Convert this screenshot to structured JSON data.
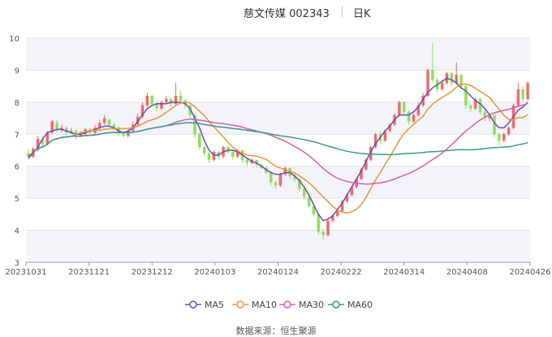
{
  "header": {
    "title": "慈文传媒 002343",
    "period": "日K"
  },
  "source": "数据来源：恒生聚源",
  "colors": {
    "up": "#f06a6a",
    "down": "#8ee05a",
    "ma5": "#6a4bb5",
    "ma10": "#e8953c",
    "ma30": "#d65fae",
    "ma60": "#3d9694"
  },
  "chart_data": {
    "type": "candlestick",
    "title": "慈文传媒 002343",
    "period": "日K",
    "ylim": [
      3,
      10
    ],
    "yticks": [
      "3",
      "4",
      "5",
      "6",
      "7",
      "8",
      "9",
      "10"
    ],
    "xticks": [
      "20231031",
      "20231121",
      "20231212",
      "20240103",
      "20240124",
      "20240222",
      "20240314",
      "20240408",
      "20240426"
    ],
    "grid": true,
    "legend_position": "bottom",
    "legend": [
      "MA5",
      "MA10",
      "MA30",
      "MA60"
    ],
    "candles": [
      [
        6.4,
        6.3,
        6.55,
        6.2
      ],
      [
        6.3,
        6.55,
        6.6,
        6.25
      ],
      [
        6.5,
        6.85,
        6.95,
        6.45
      ],
      [
        6.85,
        6.7,
        6.95,
        6.6
      ],
      [
        6.7,
        7.05,
        7.1,
        6.65
      ],
      [
        7.05,
        7.4,
        7.45,
        7.0
      ],
      [
        7.35,
        7.15,
        7.45,
        7.05
      ],
      [
        7.15,
        7.2,
        7.3,
        7.05
      ],
      [
        7.2,
        7.05,
        7.25,
        6.95
      ],
      [
        7.05,
        7.1,
        7.2,
        7.0
      ],
      [
        7.1,
        6.95,
        7.15,
        6.85
      ],
      [
        6.95,
        7.0,
        7.1,
        6.9
      ],
      [
        7.0,
        7.15,
        7.2,
        6.95
      ],
      [
        7.15,
        7.05,
        7.2,
        7.0
      ],
      [
        7.05,
        7.2,
        7.3,
        7.0
      ],
      [
        7.2,
        7.35,
        7.45,
        7.15
      ],
      [
        7.35,
        7.5,
        7.6,
        7.3
      ],
      [
        7.45,
        7.3,
        7.5,
        7.2
      ],
      [
        7.3,
        7.2,
        7.35,
        7.1
      ],
      [
        7.2,
        7.05,
        7.25,
        6.95
      ],
      [
        7.05,
        6.95,
        7.1,
        6.9
      ],
      [
        6.95,
        7.1,
        7.15,
        6.9
      ],
      [
        7.1,
        7.3,
        7.4,
        7.05
      ],
      [
        7.3,
        7.55,
        7.65,
        7.25
      ],
      [
        7.55,
        7.9,
        8.0,
        7.5
      ],
      [
        7.9,
        8.2,
        8.3,
        7.85
      ],
      [
        8.2,
        7.95,
        8.25,
        7.85
      ],
      [
        7.95,
        7.8,
        8.0,
        7.7
      ],
      [
        7.8,
        8.0,
        8.05,
        7.75
      ],
      [
        8.0,
        8.1,
        8.2,
        7.95
      ],
      [
        8.1,
        7.95,
        8.15,
        7.85
      ],
      [
        7.95,
        8.2,
        8.6,
        7.9
      ],
      [
        8.2,
        8.05,
        8.35,
        7.95
      ],
      [
        8.05,
        7.9,
        8.1,
        7.8
      ],
      [
        7.9,
        7.6,
        7.95,
        7.5
      ],
      [
        7.6,
        7.0,
        7.65,
        6.9
      ],
      [
        7.0,
        6.6,
        7.05,
        6.5
      ],
      [
        6.6,
        6.4,
        6.65,
        6.3
      ],
      [
        6.4,
        6.2,
        6.45,
        6.1
      ],
      [
        6.2,
        6.45,
        6.5,
        6.15
      ],
      [
        6.45,
        6.3,
        6.5,
        6.2
      ],
      [
        6.3,
        6.6,
        6.65,
        6.25
      ],
      [
        6.6,
        6.45,
        6.65,
        6.4
      ],
      [
        6.45,
        6.3,
        6.5,
        6.2
      ],
      [
        6.3,
        6.5,
        6.55,
        6.25
      ],
      [
        6.5,
        6.2,
        6.5,
        6.1
      ],
      [
        6.2,
        6.1,
        6.25,
        6.0
      ],
      [
        6.1,
        6.2,
        6.25,
        6.05
      ],
      [
        6.2,
        6.05,
        6.2,
        5.95
      ],
      [
        6.05,
        5.95,
        6.1,
        5.9
      ],
      [
        5.95,
        5.8,
        6.0,
        5.75
      ],
      [
        5.8,
        5.5,
        5.85,
        5.4
      ],
      [
        5.5,
        5.4,
        5.55,
        5.3
      ],
      [
        5.4,
        5.75,
        5.8,
        5.35
      ],
      [
        5.75,
        5.95,
        6.0,
        5.7
      ],
      [
        5.95,
        5.7,
        5.95,
        5.6
      ],
      [
        5.7,
        5.6,
        5.75,
        5.5
      ],
      [
        5.6,
        5.3,
        5.65,
        5.2
      ],
      [
        5.3,
        5.05,
        5.35,
        4.95
      ],
      [
        5.05,
        4.75,
        5.1,
        4.7
      ],
      [
        4.75,
        4.5,
        4.8,
        4.45
      ],
      [
        4.5,
        3.95,
        4.55,
        3.85
      ],
      [
        3.95,
        3.85,
        4.05,
        3.7
      ],
      [
        3.85,
        4.3,
        4.35,
        3.8
      ],
      [
        4.3,
        4.45,
        4.5,
        4.25
      ],
      [
        4.45,
        4.6,
        4.7,
        4.4
      ],
      [
        4.6,
        4.9,
        4.95,
        4.55
      ],
      [
        4.9,
        5.1,
        5.15,
        4.85
      ],
      [
        5.1,
        5.35,
        5.4,
        5.05
      ],
      [
        5.35,
        5.6,
        5.65,
        5.3
      ],
      [
        5.6,
        5.9,
        5.95,
        5.55
      ],
      [
        5.9,
        6.2,
        6.25,
        5.85
      ],
      [
        6.2,
        6.6,
        6.65,
        6.15
      ],
      [
        6.6,
        7.0,
        7.05,
        6.55
      ],
      [
        7.0,
        6.8,
        7.1,
        6.7
      ],
      [
        6.8,
        7.1,
        7.15,
        6.75
      ],
      [
        7.1,
        7.3,
        7.35,
        7.05
      ],
      [
        7.3,
        7.6,
        7.65,
        7.25
      ],
      [
        7.6,
        8.0,
        8.05,
        7.55
      ],
      [
        8.0,
        7.7,
        8.05,
        7.6
      ],
      [
        7.7,
        7.4,
        7.75,
        7.3
      ],
      [
        7.4,
        7.6,
        7.65,
        7.35
      ],
      [
        7.6,
        7.9,
        8.0,
        7.55
      ],
      [
        7.9,
        8.2,
        8.3,
        7.85
      ],
      [
        8.2,
        9.0,
        9.05,
        8.15
      ],
      [
        9.0,
        8.7,
        9.85,
        8.6
      ],
      [
        8.7,
        8.4,
        8.75,
        8.3
      ],
      [
        8.4,
        8.6,
        8.7,
        8.35
      ],
      [
        8.6,
        8.9,
        8.95,
        8.55
      ],
      [
        8.9,
        8.6,
        8.95,
        8.5
      ],
      [
        8.6,
        8.85,
        9.25,
        8.55
      ],
      [
        8.85,
        8.5,
        8.9,
        8.4
      ],
      [
        8.5,
        7.9,
        8.55,
        7.8
      ],
      [
        7.9,
        7.8,
        7.95,
        7.7
      ],
      [
        7.8,
        8.1,
        8.15,
        7.75
      ],
      [
        8.1,
        7.7,
        8.15,
        7.6
      ],
      [
        7.7,
        7.5,
        7.75,
        7.4
      ],
      [
        7.5,
        7.6,
        7.65,
        7.4
      ],
      [
        7.6,
        7.0,
        7.65,
        6.9
      ],
      [
        7.0,
        6.8,
        7.05,
        6.65
      ],
      [
        6.8,
        7.0,
        7.05,
        6.75
      ],
      [
        7.0,
        7.2,
        7.25,
        6.95
      ],
      [
        7.2,
        7.9,
        7.95,
        7.15
      ],
      [
        7.9,
        8.4,
        8.6,
        7.85
      ],
      [
        8.4,
        8.1,
        8.5,
        8.0
      ],
      [
        8.1,
        8.6,
        8.65,
        8.05
      ]
    ],
    "ma5": [
      6.25,
      6.4,
      6.6,
      6.85,
      7.05,
      7.1,
      7.15,
      7.15,
      7.1,
      7.05,
      7.0,
      7.0,
      7.05,
      7.1,
      7.15,
      7.2,
      7.25,
      7.25,
      7.2,
      7.1,
      7.05,
      7.1,
      7.2,
      7.4,
      7.6,
      7.8,
      7.9,
      7.95,
      7.95,
      7.95,
      8.0,
      8.0,
      8.0,
      7.95,
      7.8,
      7.5,
      7.2,
      6.8,
      6.5,
      6.35,
      6.35,
      6.45,
      6.5,
      6.5,
      6.45,
      6.35,
      6.25,
      6.15,
      6.1,
      6.0,
      5.9,
      5.8,
      5.75,
      5.75,
      5.8,
      5.8,
      5.7,
      5.55,
      5.35,
      5.1,
      4.8,
      4.5,
      4.3,
      4.35,
      4.45,
      4.65,
      4.85,
      5.1,
      5.35,
      5.6,
      5.85,
      6.15,
      6.45,
      6.7,
      6.9,
      7.1,
      7.25,
      7.45,
      7.6,
      7.6,
      7.6,
      7.7,
      7.85,
      8.1,
      8.3,
      8.45,
      8.55,
      8.65,
      8.75,
      8.7,
      8.6,
      8.45,
      8.35,
      8.2,
      8.05,
      7.95,
      7.8,
      7.6,
      7.35,
      7.2,
      7.2,
      7.35,
      7.55,
      7.75,
      7.85,
      8.0
    ]
  }
}
